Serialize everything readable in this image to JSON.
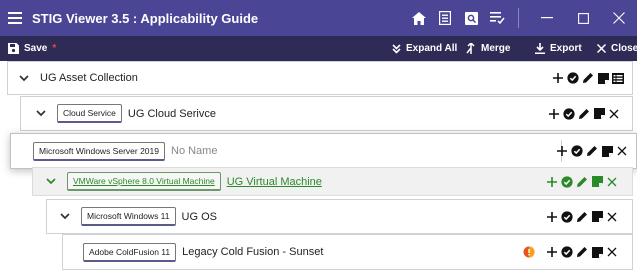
{
  "window": {
    "title": "STIG Viewer 3.5 : Applicability Guide"
  },
  "toolbar": {
    "save_label": "Save",
    "save_dirty_marker": "*",
    "expand_all_label": "Expand All",
    "merge_label": "Merge",
    "export_label": "Export",
    "close_label": "Close"
  },
  "tree": {
    "rows": [
      {
        "tag": "",
        "name": "UG Asset Collection",
        "state": "expanded"
      },
      {
        "tag": "Cloud Service",
        "name": "UG Cloud Serivce",
        "state": "expanded"
      },
      {
        "tag": "Microsoft Windows Server 2019",
        "name": "No Name",
        "state": "dragging"
      },
      {
        "tag": "VMWare vSphere 8.0 Virtual Machine",
        "name": "UG Virtual Machine",
        "state": "drop-target"
      },
      {
        "tag": "Microsoft Windows 11",
        "name": "UG OS",
        "state": "expanded"
      },
      {
        "tag": "Adobe ColdFusion 11",
        "name": "Legacy Cold Fusion - Sunset",
        "state": "leaf"
      }
    ]
  },
  "colors": {
    "titlebar": "#4b4596",
    "toolbar": "#2e2b57",
    "drop_target_text": "#2a8a2a",
    "warning_icon": "#e8541a"
  }
}
